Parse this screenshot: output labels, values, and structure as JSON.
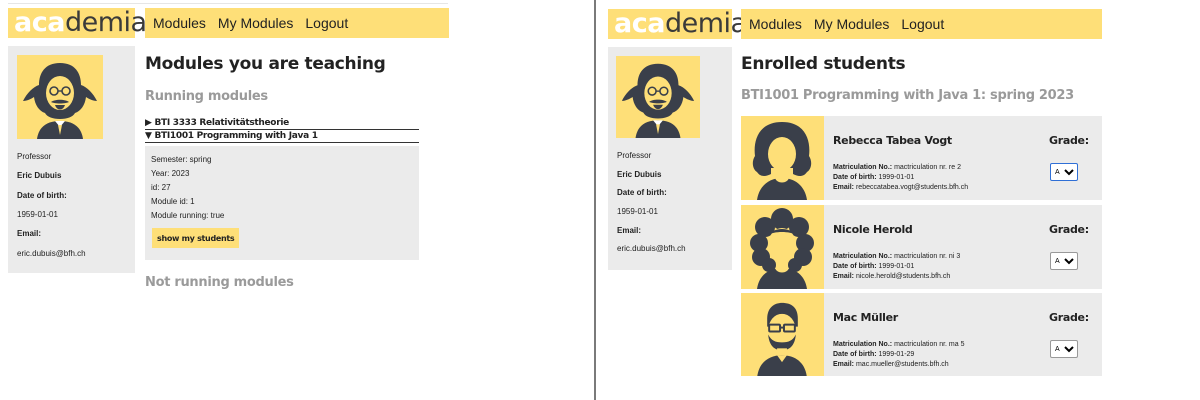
{
  "brand": {
    "part1": "aca",
    "part2": "demia"
  },
  "nav": {
    "modules": "Modules",
    "my_modules": "My Modules",
    "logout": "Logout"
  },
  "profile": {
    "role": "Professor",
    "name": "Eric Dubuis",
    "dob_label": "Date of birth:",
    "dob": "1959-01-01",
    "email_label": "Email:",
    "email": "eric.dubuis@bfh.ch"
  },
  "left": {
    "title": "Modules you are teaching",
    "running_heading": "Running modules",
    "modules": [
      {
        "label": "BTI 3333 Relativitätstheorie",
        "marker": "▶"
      },
      {
        "label": "BTI1001 Programming with Java 1",
        "marker": "▼"
      }
    ],
    "details": {
      "semester": "Semester: spring",
      "year": "Year: 2023",
      "id": "id: 27",
      "module_id": "Module id: 1",
      "running": "Module running: true",
      "button": "show my students"
    },
    "not_running_heading": "Not running modules"
  },
  "right": {
    "title": "Enrolled students",
    "subtitle": "BTI1001 Programming with Java 1: spring 2023",
    "grade_label": "Grade:",
    "matric_label": "Matriculation No.:",
    "dob_label": "Date of birth:",
    "email_label": "Email:",
    "students": [
      {
        "name": "Rebecca Tabea Vogt",
        "matric": "mactriculation nr. re 2",
        "dob": "1999-01-01",
        "email": "rebeccatabea.vogt@students.bfh.ch",
        "grade": "A"
      },
      {
        "name": "Nicole Herold",
        "matric": "mactriculation nr. ni 3",
        "dob": "1999-01-01",
        "email": "nicole.herold@students.bfh.ch",
        "grade": "A"
      },
      {
        "name": "Mac Müller",
        "matric": "mactriculation nr. ma 5",
        "dob": "1999-01-29",
        "email": "mac.mueller@students.bfh.ch",
        "grade": "A"
      }
    ]
  },
  "colors": {
    "accent": "#fedf78",
    "panel": "#ebebeb",
    "muted": "#9a9a9a",
    "ink": "#3a3f4a"
  }
}
